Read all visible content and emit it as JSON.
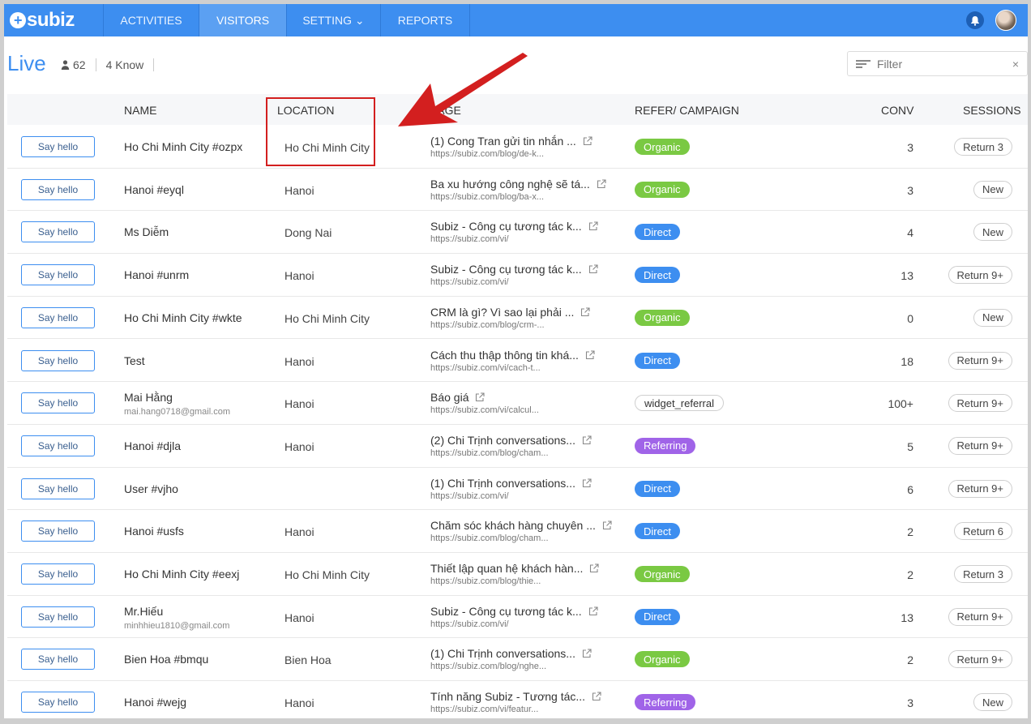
{
  "app": {
    "logo": "subiz",
    "logo_mark": "+"
  },
  "nav": {
    "items": [
      "ACTIVITIES",
      "VISITORS",
      "SETTING ⌄",
      "REPORTS"
    ],
    "active": "VISITORS"
  },
  "header": {
    "title": "Live",
    "visitor_count": "62",
    "known": "4 Know"
  },
  "filter": {
    "placeholder": "Filter",
    "clear": "×"
  },
  "table": {
    "columns": {
      "name": "NAME",
      "location": "LOCATION",
      "page": "PAGE",
      "refer": "REFER/ CAMPAIGN",
      "conv": "CONV",
      "sessions": "SESSIONS"
    },
    "action_label": "Say hello",
    "rows": [
      {
        "name": "Ho Chi Minh City #ozpx",
        "email": "",
        "location": "Ho Chi Minh City",
        "page_title": "(1) Cong Tran gửi tin nhắn ...",
        "page_url": "https://subiz.com/blog/de-k...",
        "refer": "Organic",
        "conv": "3",
        "session": "Return 3"
      },
      {
        "name": "Hanoi #eyql",
        "email": "",
        "location": "Hanoi",
        "page_title": "Ba xu hướng công nghệ sẽ tá...",
        "page_url": "https://subiz.com/blog/ba-x...",
        "refer": "Organic",
        "conv": "3",
        "session": "New"
      },
      {
        "name": "Ms Diễm",
        "email": "",
        "location": "Dong Nai",
        "page_title": "Subiz - Công cụ tương tác k...",
        "page_url": "https://subiz.com/vi/",
        "refer": "Direct",
        "conv": "4",
        "session": "New"
      },
      {
        "name": "Hanoi #unrm",
        "email": "",
        "location": "Hanoi",
        "page_title": "Subiz - Công cụ tương tác k...",
        "page_url": "https://subiz.com/vi/",
        "refer": "Direct",
        "conv": "13",
        "session": "Return 9+"
      },
      {
        "name": "Ho Chi Minh City #wkte",
        "email": "",
        "location": "Ho Chi Minh City",
        "page_title": "CRM là gì? Vì sao lại phải ...",
        "page_url": "https://subiz.com/blog/crm-...",
        "refer": "Organic",
        "conv": "0",
        "session": "New"
      },
      {
        "name": "Test",
        "email": "",
        "location": "Hanoi",
        "page_title": "Cách thu thập thông tin khá...",
        "page_url": "https://subiz.com/vi/cach-t...",
        "refer": "Direct",
        "conv": "18",
        "session": "Return 9+"
      },
      {
        "name": "Mai Hằng",
        "email": "mai.hang0718@gmail.com",
        "location": "Hanoi",
        "page_title": "Báo giá",
        "page_url": "https://subiz.com/vi/calcul...",
        "refer": "widget_referral",
        "conv": "100+",
        "session": "Return 9+"
      },
      {
        "name": "Hanoi #djla",
        "email": "",
        "location": "Hanoi",
        "page_title": "(2) Chi Trịnh conversations...",
        "page_url": "https://subiz.com/blog/cham...",
        "refer": "Referring",
        "conv": "5",
        "session": "Return 9+"
      },
      {
        "name": "User #vjho",
        "email": "",
        "location": "",
        "page_title": "(1) Chi Trịnh conversations...",
        "page_url": "https://subiz.com/vi/",
        "refer": "Direct",
        "conv": "6",
        "session": "Return 9+"
      },
      {
        "name": "Hanoi #usfs",
        "email": "",
        "location": "Hanoi",
        "page_title": "Chăm sóc khách hàng chuyên ...",
        "page_url": "https://subiz.com/blog/cham...",
        "refer": "Direct",
        "conv": "2",
        "session": "Return 6"
      },
      {
        "name": "Ho Chi Minh City #eexj",
        "email": "",
        "location": "Ho Chi Minh City",
        "page_title": "Thiết lập quan hệ khách hàn...",
        "page_url": "https://subiz.com/blog/thie...",
        "refer": "Organic",
        "conv": "2",
        "session": "Return 3"
      },
      {
        "name": "Mr.Hiếu",
        "email": "minhhieu1810@gmail.com",
        "location": "Hanoi",
        "page_title": "Subiz - Công cụ tương tác k...",
        "page_url": "https://subiz.com/vi/",
        "refer": "Direct",
        "conv": "13",
        "session": "Return 9+"
      },
      {
        "name": "Bien Hoa #bmqu",
        "email": "",
        "location": "Bien Hoa",
        "page_title": "(1) Chi Trịnh conversations...",
        "page_url": "https://subiz.com/blog/nghe...",
        "refer": "Organic",
        "conv": "2",
        "session": "Return 9+"
      },
      {
        "name": "Hanoi #wejg",
        "email": "",
        "location": "Hanoi",
        "page_title": "Tính năng Subiz - Tương tác...",
        "page_url": "https://subiz.com/vi/featur...",
        "refer": "Referring",
        "conv": "3",
        "session": "New"
      }
    ]
  },
  "colors": {
    "brand": "#3d8ef0",
    "organic": "#7ac943",
    "direct": "#3d8ef0",
    "referring": "#a064e8",
    "annotation": "#d31f1f"
  }
}
